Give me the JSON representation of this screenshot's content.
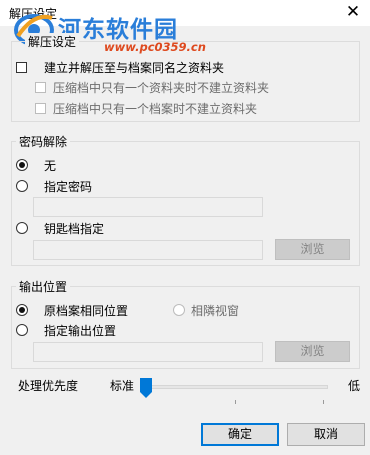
{
  "window": {
    "title": "解压设定",
    "close_glyph": "✕"
  },
  "watermark": {
    "text": "河东软件园",
    "url": "www.pc0359.cn"
  },
  "extract": {
    "legend": "解压设定",
    "create_folder_label": "建立并解压至与档案同名之资料夹",
    "create_folder_checked": false,
    "sub1_label": "压缩档中只有一个资料夹时不建立资料夹",
    "sub1_checked": false,
    "sub2_label": "压缩档中只有一个档案时不建立资料夹",
    "sub2_checked": false
  },
  "password": {
    "legend": "密码解除",
    "none_label": "无",
    "specify_label": "指定密码",
    "password_value": "",
    "keyfile_label": "钥匙档指定",
    "keyfile_value": "",
    "browse_label": "浏览",
    "selected": "none"
  },
  "output": {
    "legend": "输出位置",
    "same_label": "原档案相同位置",
    "adjacent_label": "相隣视窗",
    "specify_label": "指定输出位置",
    "path_value": "",
    "browse_label": "浏览",
    "selected": "same"
  },
  "priority": {
    "label": "处理优先度",
    "left_label": "标准",
    "right_label": "低",
    "level": 0
  },
  "buttons": {
    "ok": "确定",
    "cancel": "取消"
  },
  "colors": {
    "watermark_text": "#2a7ed9",
    "watermark_url": "#de4a1f",
    "slider_thumb": "#0078d7",
    "default_button_border": "#0078d7"
  },
  "icons": {
    "close": "close-icon",
    "logo": "watermark-logo-icon"
  }
}
